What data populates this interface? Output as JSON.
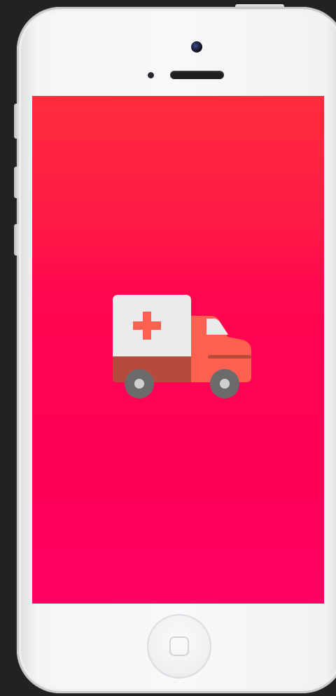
{
  "device": {
    "model": "iphone-5-white"
  },
  "splash_screen": {
    "background_gradient": [
      "#ff2c3c",
      "#ff0055",
      "#ff0062"
    ],
    "logo_icon": "ambulance-icon",
    "logo_colors": {
      "cabin_panel": "#ebebeb",
      "cross": "#ff6050",
      "body_lower": "#b74a3c",
      "front_cab": "#ff6050",
      "window": "#ebebeb",
      "wheels": "#6b6b6b"
    }
  },
  "hardware": {
    "home_button_icon": "home-button-icon",
    "camera_icon": "front-camera-icon",
    "speaker_icon": "earpiece-speaker-icon"
  }
}
